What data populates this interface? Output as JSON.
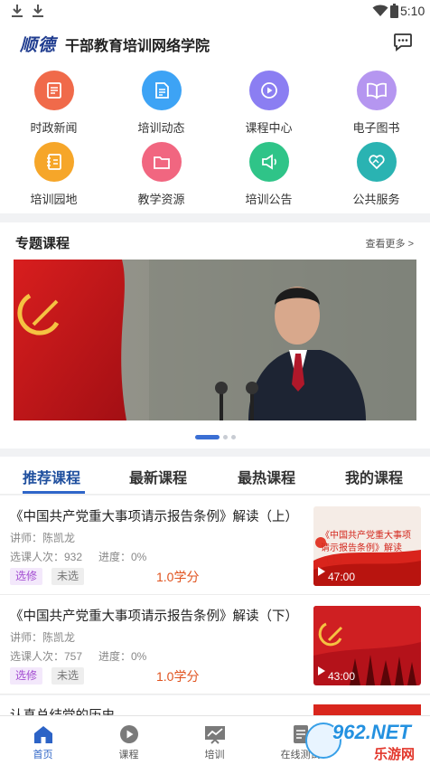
{
  "status_bar": {
    "time": "5:10"
  },
  "header": {
    "logo_text": "顺德",
    "title": "干部教育培训网络学院"
  },
  "grid_items": [
    {
      "label": "时政新闻",
      "icon": "newspaper-icon",
      "color": "#f06a4a"
    },
    {
      "label": "培训动态",
      "icon": "document-icon",
      "color": "#3da3f5"
    },
    {
      "label": "课程中心",
      "icon": "play-circle-icon",
      "color": "#8b7ef2"
    },
    {
      "label": "电子图书",
      "icon": "open-book-icon",
      "color": "#b596f0"
    },
    {
      "label": "培训园地",
      "icon": "notebook-icon",
      "color": "#f6a629"
    },
    {
      "label": "教学资源",
      "icon": "folder-icon",
      "color": "#f16680"
    },
    {
      "label": "培训公告",
      "icon": "megaphone-icon",
      "color": "#2fc488"
    },
    {
      "label": "公共服务",
      "icon": "handshake-heart-icon",
      "color": "#2ab3b2"
    }
  ],
  "topic": {
    "title": "专题课程",
    "more": "查看更多 >"
  },
  "tabs": [
    {
      "label": "推荐课程",
      "active": true
    },
    {
      "label": "最新课程",
      "active": false
    },
    {
      "label": "最热课程",
      "active": false
    },
    {
      "label": "我的课程",
      "active": false
    }
  ],
  "courses": [
    {
      "title": "《中国共产党重大事项请示报告条例》解读（上）",
      "teacher": "讲师：陈凯龙",
      "enrolled": "选课人次：932",
      "progress": "进度：0%",
      "tag_elective": "选修",
      "tag_status": "未选",
      "credit": "1.0学分",
      "duration": "47:00",
      "thumb_caption": "《中国共产党重大事项请示报告条例》解读（上）"
    },
    {
      "title": "《中国共产党重大事项请示报告条例》解读（下）",
      "teacher": "讲师：陈凯龙",
      "enrolled": "选课人次：757",
      "progress": "进度：0%",
      "tag_elective": "选修",
      "tag_status": "未选",
      "credit": "1.0学分",
      "duration": "43:00",
      "thumb_caption": ""
    }
  ],
  "partial_course": {
    "title": "认真总结党的历史"
  },
  "tabbar": [
    {
      "label": "首页",
      "icon": "home-icon",
      "active": true
    },
    {
      "label": "课程",
      "icon": "play-icon",
      "active": false
    },
    {
      "label": "培训",
      "icon": "chart-board-icon",
      "active": false
    },
    {
      "label": "在线测试",
      "icon": "test-icon",
      "active": false
    }
  ],
  "watermark": {
    "brand": "962.NET",
    "sub": "乐游网"
  },
  "colors": {
    "accent": "#2f66c9",
    "credit": "#e0521e",
    "elective": "#a24bd1"
  }
}
